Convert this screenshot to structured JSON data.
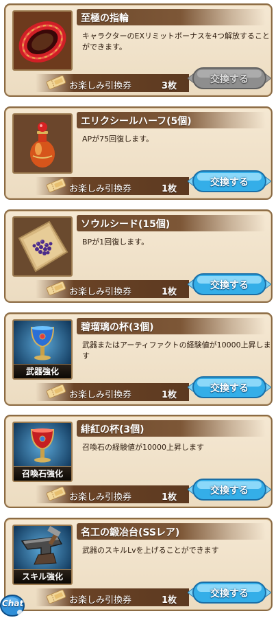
{
  "currency": {
    "name": "お楽しみ引換券",
    "icon": "ticket-icon"
  },
  "exchange_label": "交換する",
  "chat_label": "Chat",
  "colors": {
    "card_bg": "#f0e3cc",
    "card_border": "#8b6b44",
    "title_bar": "#6f4a2d",
    "button_active": "#3ab4ee",
    "button_disabled": "#8e8e8e"
  },
  "items": [
    {
      "name": "至極の指輪",
      "description": "キャラクターのEXリミットボーナスを4つ解放することができます。",
      "cost": "3枚",
      "image": "ring-icon",
      "enhance_label": "",
      "exchange_enabled": false
    },
    {
      "name": "エリクシールハーフ(5個)",
      "description": "APが75回復します。",
      "cost": "1枚",
      "image": "elixir-potion-icon",
      "enhance_label": "",
      "exchange_enabled": true
    },
    {
      "name": "ソウルシード(15個)",
      "description": "BPが1回復します。",
      "cost": "1枚",
      "image": "soul-seed-icon",
      "enhance_label": "",
      "exchange_enabled": true
    },
    {
      "name": "碧瑠璃の杯(3個)",
      "description": "武器またはアーティファクトの経験値が10000上昇します",
      "cost": "1枚",
      "image": "blue-chalice-icon",
      "enhance_label": "武器強化",
      "exchange_enabled": true
    },
    {
      "name": "緋紅の杯(3個)",
      "description": "召喚石の経験値が10000上昇します",
      "cost": "1枚",
      "image": "red-chalice-icon",
      "enhance_label": "召喚石強化",
      "exchange_enabled": true
    },
    {
      "name": "名工の鍛冶台(SSレア)",
      "description": "武器のスキルLvを上げることができます",
      "cost": "1枚",
      "image": "anvil-icon",
      "enhance_label": "スキル強化",
      "exchange_enabled": true
    }
  ]
}
